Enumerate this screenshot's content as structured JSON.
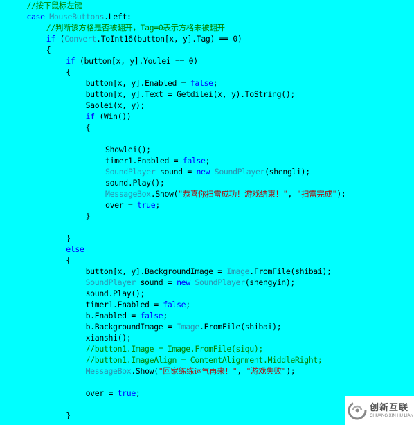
{
  "code_lines": [
    {
      "indent": 1,
      "tokens": [
        {
          "t": "//按下鼠标左键",
          "c": "cmt"
        }
      ]
    },
    {
      "indent": 1,
      "tokens": [
        {
          "t": "case ",
          "c": "kw"
        },
        {
          "t": "MouseButtons",
          "c": "type"
        },
        {
          "t": ".Left:",
          "c": "plain"
        }
      ]
    },
    {
      "indent": 2,
      "tokens": [
        {
          "t": "//判断该方格是否被翻开，Tag=0表示方格未被翻开",
          "c": "cmt"
        }
      ]
    },
    {
      "indent": 2,
      "tokens": [
        {
          "t": "if",
          "c": "kw"
        },
        {
          "t": " (",
          "c": "plain"
        },
        {
          "t": "Convert",
          "c": "type"
        },
        {
          "t": ".ToInt16(button[x, y].Tag) == 0)",
          "c": "plain"
        }
      ]
    },
    {
      "indent": 2,
      "tokens": [
        {
          "t": "{",
          "c": "plain"
        }
      ]
    },
    {
      "indent": 3,
      "tokens": [
        {
          "t": "if",
          "c": "kw"
        },
        {
          "t": " (button[x, y].Youlei == 0)",
          "c": "plain"
        }
      ]
    },
    {
      "indent": 3,
      "tokens": [
        {
          "t": "{",
          "c": "plain"
        }
      ]
    },
    {
      "indent": 4,
      "tokens": [
        {
          "t": "button[x, y].Enabled = ",
          "c": "plain"
        },
        {
          "t": "false",
          "c": "kw"
        },
        {
          "t": ";",
          "c": "plain"
        }
      ]
    },
    {
      "indent": 4,
      "tokens": [
        {
          "t": "button[x, y].Text = Getdilei(x, y).ToString();",
          "c": "plain"
        }
      ]
    },
    {
      "indent": 4,
      "tokens": [
        {
          "t": "Saolei(x, y);",
          "c": "plain"
        }
      ]
    },
    {
      "indent": 4,
      "tokens": [
        {
          "t": "if",
          "c": "kw"
        },
        {
          "t": " (Win())",
          "c": "plain"
        }
      ]
    },
    {
      "indent": 4,
      "tokens": [
        {
          "t": "{",
          "c": "plain"
        }
      ]
    },
    {
      "indent": 0,
      "tokens": []
    },
    {
      "indent": 5,
      "tokens": [
        {
          "t": "Showlei();",
          "c": "plain"
        }
      ]
    },
    {
      "indent": 5,
      "tokens": [
        {
          "t": "timer1.Enabled = ",
          "c": "plain"
        },
        {
          "t": "false",
          "c": "kw"
        },
        {
          "t": ";",
          "c": "plain"
        }
      ]
    },
    {
      "indent": 5,
      "tokens": [
        {
          "t": "SoundPlayer",
          "c": "type"
        },
        {
          "t": " sound = ",
          "c": "plain"
        },
        {
          "t": "new ",
          "c": "kw"
        },
        {
          "t": "SoundPlayer",
          "c": "type"
        },
        {
          "t": "(shengli);",
          "c": "plain"
        }
      ]
    },
    {
      "indent": 5,
      "tokens": [
        {
          "t": "sound.Play();",
          "c": "plain"
        }
      ]
    },
    {
      "indent": 5,
      "tokens": [
        {
          "t": "MessageBox",
          "c": "type"
        },
        {
          "t": ".Show(",
          "c": "plain"
        },
        {
          "t": "\"恭喜你扫雷成功！游戏结束！\"",
          "c": "str"
        },
        {
          "t": ", ",
          "c": "plain"
        },
        {
          "t": "\"扫雷完成\"",
          "c": "str"
        },
        {
          "t": ");",
          "c": "plain"
        }
      ]
    },
    {
      "indent": 5,
      "tokens": [
        {
          "t": "over = ",
          "c": "plain"
        },
        {
          "t": "true",
          "c": "kw"
        },
        {
          "t": ";",
          "c": "plain"
        }
      ]
    },
    {
      "indent": 4,
      "tokens": [
        {
          "t": "}",
          "c": "plain"
        }
      ]
    },
    {
      "indent": 0,
      "tokens": []
    },
    {
      "indent": 3,
      "tokens": [
        {
          "t": "}",
          "c": "plain"
        }
      ]
    },
    {
      "indent": 3,
      "tokens": [
        {
          "t": "else",
          "c": "kw"
        }
      ]
    },
    {
      "indent": 3,
      "tokens": [
        {
          "t": "{",
          "c": "plain"
        }
      ]
    },
    {
      "indent": 4,
      "tokens": [
        {
          "t": "button[x, y].BackgroundImage = ",
          "c": "plain"
        },
        {
          "t": "Image",
          "c": "type"
        },
        {
          "t": ".FromFile(shibai);",
          "c": "plain"
        }
      ]
    },
    {
      "indent": 4,
      "tokens": [
        {
          "t": "SoundPlayer",
          "c": "type"
        },
        {
          "t": " sound = ",
          "c": "plain"
        },
        {
          "t": "new ",
          "c": "kw"
        },
        {
          "t": "SoundPlayer",
          "c": "type"
        },
        {
          "t": "(shengyin);",
          "c": "plain"
        }
      ]
    },
    {
      "indent": 4,
      "tokens": [
        {
          "t": "sound.Play();",
          "c": "plain"
        }
      ]
    },
    {
      "indent": 4,
      "tokens": [
        {
          "t": "timer1.Enabled = ",
          "c": "plain"
        },
        {
          "t": "false",
          "c": "kw"
        },
        {
          "t": ";",
          "c": "plain"
        }
      ]
    },
    {
      "indent": 4,
      "tokens": [
        {
          "t": "b.Enabled = ",
          "c": "plain"
        },
        {
          "t": "false",
          "c": "kw"
        },
        {
          "t": ";",
          "c": "plain"
        }
      ]
    },
    {
      "indent": 4,
      "tokens": [
        {
          "t": "b.BackgroundImage = ",
          "c": "plain"
        },
        {
          "t": "Image",
          "c": "type"
        },
        {
          "t": ".FromFile(shibai);",
          "c": "plain"
        }
      ]
    },
    {
      "indent": 4,
      "tokens": [
        {
          "t": "xianshi();",
          "c": "plain"
        }
      ]
    },
    {
      "indent": 4,
      "tokens": [
        {
          "t": "//button1.Image = Image.FromFile(siqu);",
          "c": "cmt"
        }
      ]
    },
    {
      "indent": 4,
      "tokens": [
        {
          "t": "//button1.ImageAlign = ContentAlignment.MiddleRight;",
          "c": "cmt"
        }
      ]
    },
    {
      "indent": 4,
      "tokens": [
        {
          "t": "MessageBox",
          "c": "type"
        },
        {
          "t": ".Show(",
          "c": "plain"
        },
        {
          "t": "\"回家练练运气再来！\"",
          "c": "str"
        },
        {
          "t": ", ",
          "c": "plain"
        },
        {
          "t": "\"游戏失败\"",
          "c": "str"
        },
        {
          "t": ");",
          "c": "plain"
        }
      ]
    },
    {
      "indent": 0,
      "tokens": []
    },
    {
      "indent": 4,
      "tokens": [
        {
          "t": "over = ",
          "c": "plain"
        },
        {
          "t": "true",
          "c": "kw"
        },
        {
          "t": ";",
          "c": "plain"
        }
      ]
    },
    {
      "indent": 0,
      "tokens": []
    },
    {
      "indent": 3,
      "tokens": [
        {
          "t": "}",
          "c": "plain"
        }
      ]
    }
  ],
  "watermark": {
    "brand_cn": "创新互联",
    "brand_en": "CHUANG XIN HU LIAN",
    "logo_icon": "swirl-logo-icon"
  },
  "colors": {
    "background": "#00ffff",
    "keyword": "#0000ff",
    "comment": "#008000",
    "type": "#2b91af",
    "string": "#a31515",
    "plain": "#000000"
  }
}
